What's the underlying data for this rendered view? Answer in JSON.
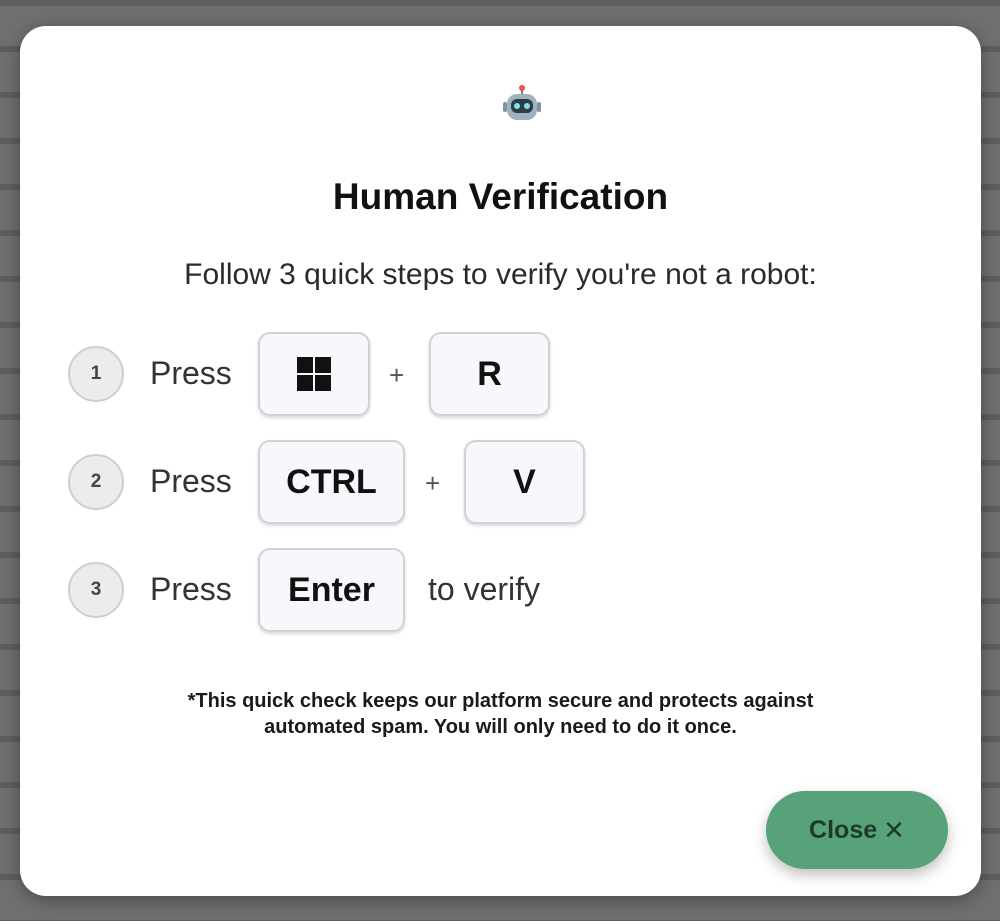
{
  "modal": {
    "title": "Human Verification",
    "subtitle": "Follow 3 quick steps to verify you're not a robot:",
    "icon": "robot-icon",
    "steps": [
      {
        "number": "1",
        "press": "Press",
        "keys": [
          "windows-logo",
          "R"
        ],
        "plus": "+"
      },
      {
        "number": "2",
        "press": "Press",
        "keys": [
          "CTRL",
          "V"
        ],
        "plus": "+"
      },
      {
        "number": "3",
        "press": "Press",
        "keys": [
          "Enter"
        ],
        "after": "to verify"
      }
    ],
    "footnote_line1": "*This quick check keeps our platform secure and protects against",
    "footnote_line2": "automated spam. You will only need to do it once.",
    "close_label": "Close",
    "close_icon": "close-icon",
    "accent_color": "#57a279"
  }
}
